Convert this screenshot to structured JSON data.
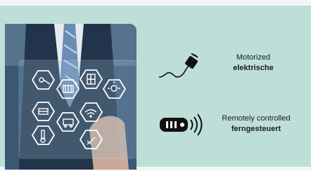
{
  "features": [
    {
      "icon": "power-plug-icon",
      "line1": "Motorized",
      "line2": "elektrische"
    },
    {
      "icon": "remote-control-icon",
      "line1": "Remotely controlled",
      "line2": "ferngesteuert"
    }
  ],
  "colors": {
    "background": "#bddfd8",
    "icon": "#111111"
  }
}
